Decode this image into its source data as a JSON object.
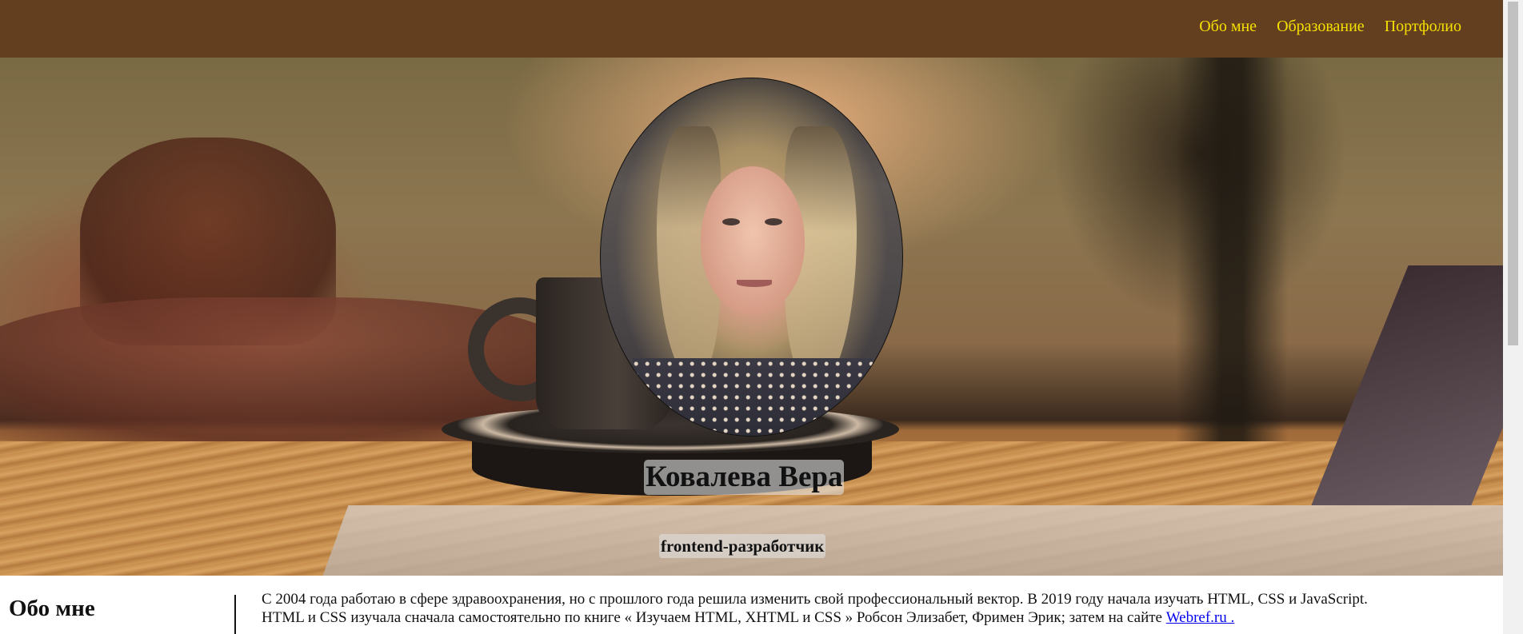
{
  "nav": {
    "items": [
      {
        "label": "Обо мне"
      },
      {
        "label": "Образование"
      },
      {
        "label": "Портфолио"
      }
    ]
  },
  "hero": {
    "name": "Ковалева Вера",
    "title": "frontend-разработчик"
  },
  "about": {
    "heading": "Обо мне",
    "text_before_link": "С 2004 года работаю в сфере здравоохранения, но с прошлого года решила изменить свой профессиональный вектор. В 2019 году начала изучать HTML, CSS и JavaScript. HTML и CSS изучала сначала самостоятельно по книге « Изучаем HTML, XHTML и CSS » Робсон Элизабет, Фримен Эрик; затем на сайте ",
    "link_label": "Webref.ru ."
  },
  "colors": {
    "topbar": "#633e1f",
    "nav_link": "#f5e000",
    "link": "#0000ee"
  }
}
